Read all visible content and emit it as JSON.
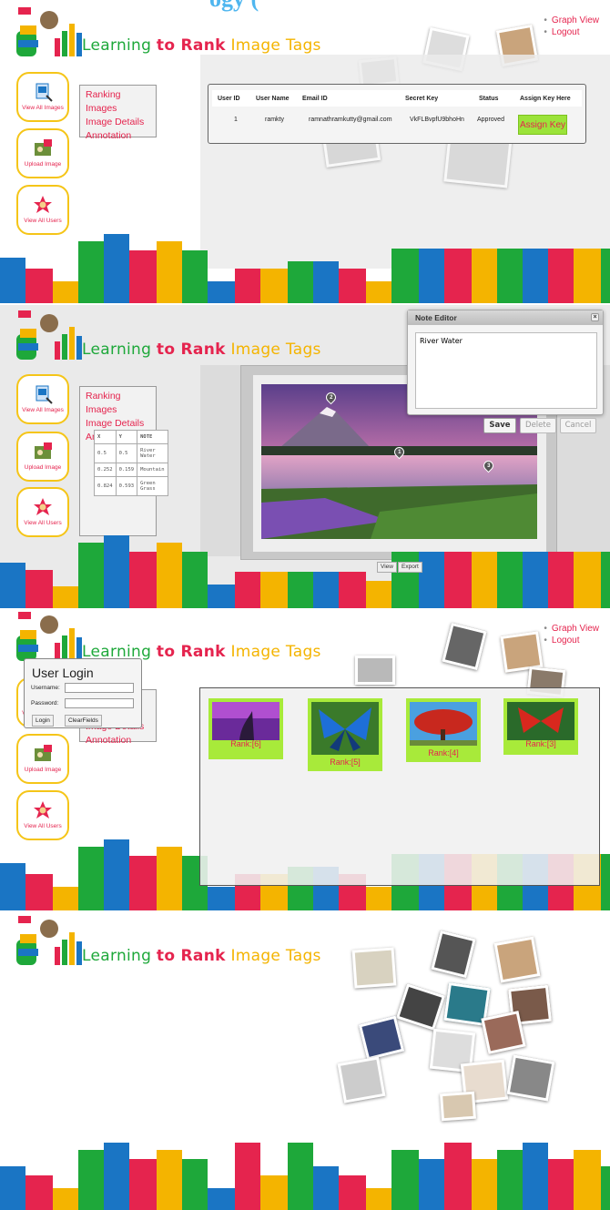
{
  "title_partial": "ogy (",
  "brand": {
    "w1": "Learning",
    "w2": "to Rank",
    "w3": "Image Tags"
  },
  "toplinks": [
    "Graph View",
    "Logout"
  ],
  "sidebar": [
    {
      "label": "View All Images",
      "icon": "image-view-icon"
    },
    {
      "label": "Upload Image",
      "icon": "upload-image-icon"
    },
    {
      "label": "View All Users",
      "icon": "users-star-icon"
    }
  ],
  "menu": [
    "Ranking Images",
    "Image Details",
    "Annotation"
  ],
  "users_table": {
    "headers": [
      "User ID",
      "User Name",
      "Email ID",
      "Secret Key",
      "Status",
      "Assign Key Here"
    ],
    "row": [
      "1",
      "ramkty",
      "ramnathramkutty@gmail.com",
      "VkFLBvpfU9bhoHn",
      "Approved"
    ],
    "assign_label": "Assign Key"
  },
  "note_editor": {
    "title": "Note Editor",
    "text": "River Water",
    "buttons": [
      "Save",
      "Delete",
      "Cancel"
    ]
  },
  "annotation_pins": [
    "2",
    "1",
    "3"
  ],
  "notes_table": {
    "headers": [
      "X",
      "Y",
      "NOTE"
    ],
    "rows": [
      [
        "0.5",
        "0.5",
        "River Water"
      ],
      [
        "0.252",
        "0.159",
        "Mountain"
      ],
      [
        "0.824",
        "0.593",
        "Green Grass"
      ]
    ]
  },
  "view_buttons": [
    "View",
    "Export"
  ],
  "ranked_images": [
    "Rank:[6]",
    "Rank:[5]",
    "Rank:[4]",
    "Rank:[3]"
  ],
  "login": {
    "title": "User Login",
    "username_label": "Username:",
    "password_label": "Password:",
    "login_btn": "Login",
    "clear_btn": "ClearFields"
  },
  "colors": {
    "pink": "#e5244e",
    "green": "#1ea83a",
    "yellow": "#f4b400",
    "blue": "#1a75c4",
    "lime": "#a8ea3a"
  }
}
